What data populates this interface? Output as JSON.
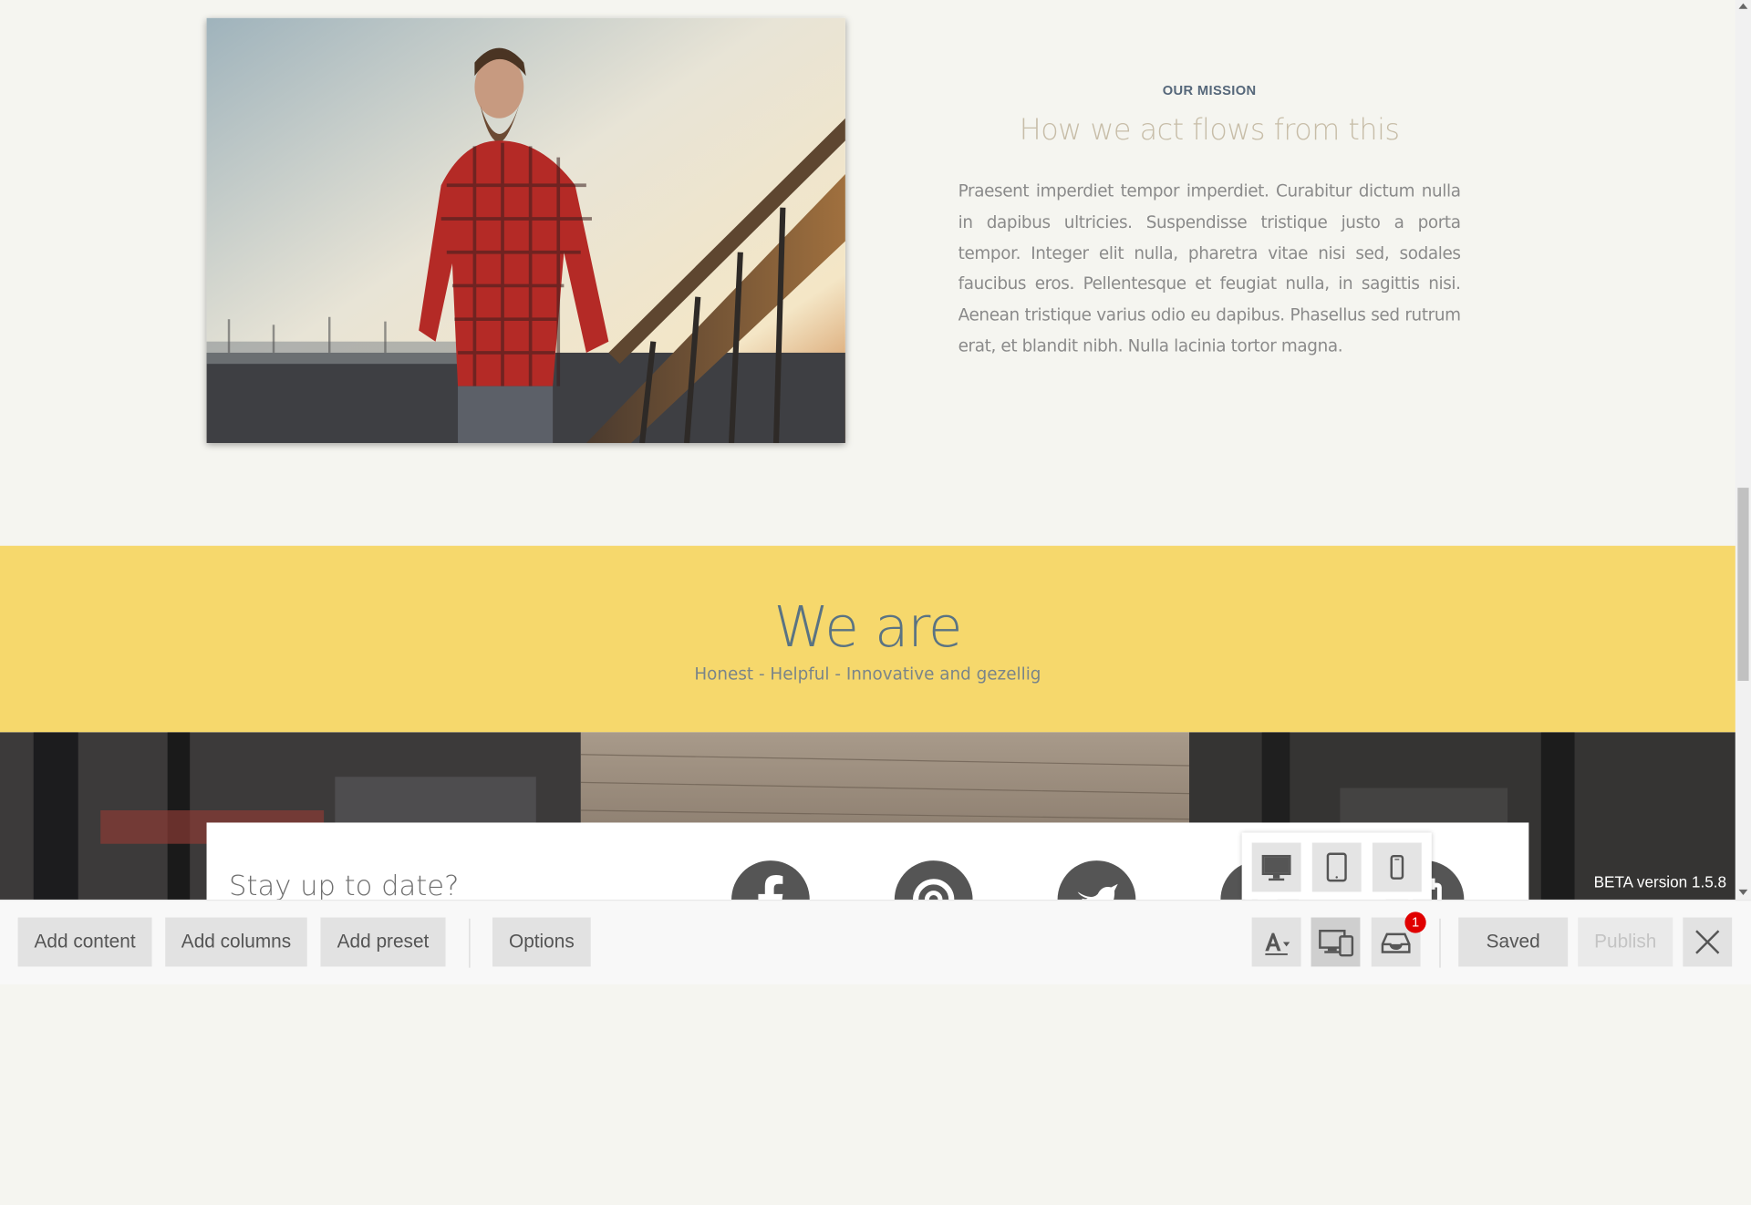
{
  "mission": {
    "eyebrow": "OUR MISSION",
    "title": "How we act flows from this",
    "body": "Praesent imperdiet tempor imperdiet. Curabitur dictum nulla in dapibus ultricies. Suspendisse tristique justo a porta tempor. Integer elit nulla, pharetra vitae nisi sed, sodales faucibus eros. Pellentesque et feugiat nulla, in sagittis nisi. Aenean tristique varius odio eu dapibus. Phasellus sed rutrum erat, et blandit nibh. Nulla lacinia tortor magna."
  },
  "weare": {
    "title": "We are",
    "subtitle": "Honest - Helpful - Innovative and gezellig"
  },
  "newsletter": {
    "title": "Stay up to date?"
  },
  "social": [
    "facebook-icon",
    "at-sign-icon",
    "twitter-icon",
    "linkedin-icon",
    "calendar-icon"
  ],
  "beta_label": "BETA version 1.5.8",
  "device_popup": {
    "options": [
      "desktop-icon",
      "tablet-icon",
      "mobile-icon"
    ]
  },
  "toolbar": {
    "add_content": "Add content",
    "add_columns": "Add columns",
    "add_preset": "Add preset",
    "options": "Options",
    "saved": "Saved",
    "publish": "Publish",
    "notification_count": "1"
  },
  "colors": {
    "accent_yellow": "#f6d86c",
    "heading_blue": "#5a7383",
    "badge_red": "#e00000"
  }
}
